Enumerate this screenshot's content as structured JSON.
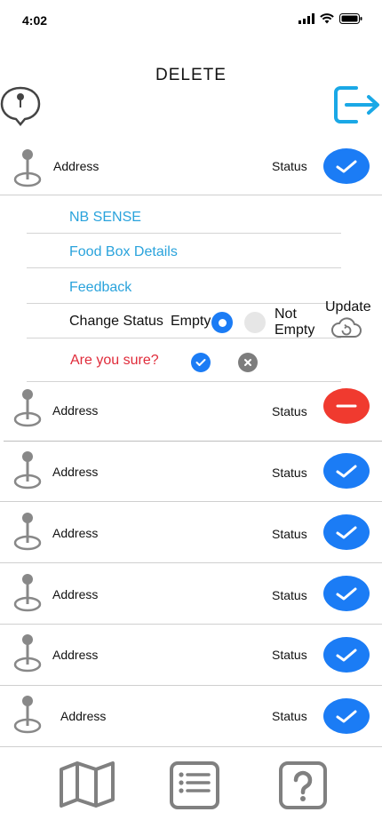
{
  "status_bar": {
    "time": "4:02"
  },
  "header": {
    "title": "DELETE"
  },
  "rows": [
    {
      "address": "Address",
      "status": "Status",
      "action": "check"
    },
    {
      "address": "Address",
      "status": "Status",
      "action": "minus"
    },
    {
      "address": "Address",
      "status": "Status",
      "action": "check"
    },
    {
      "address": "Address",
      "status": "Status",
      "action": "check"
    },
    {
      "address": "Address",
      "status": "Status",
      "action": "check"
    },
    {
      "address": "Address",
      "status": "Status",
      "action": "check"
    },
    {
      "address": "Address",
      "status": "Status",
      "action": "check"
    }
  ],
  "menu": {
    "nb_sense": "NB SENSE",
    "food_box_details": "Food Box Details",
    "feedback": "Feedback",
    "change_status": "Change Status",
    "option_empty": "Empty",
    "option_not_empty_line1": "Not",
    "option_not_empty_line2": "Empty",
    "selected_option": "Empty",
    "update": "Update",
    "confirm_prompt": "Are you sure?"
  },
  "colors": {
    "accent_blue": "#1b7cf5",
    "link_blue": "#2aa3dc",
    "delete_red": "#f03a2f",
    "warning_red": "#e02b3a",
    "icon_gray": "#888888"
  },
  "icons": {
    "header_left": "map-pin-bubble-icon",
    "header_right": "logout-icon",
    "row": "map-pin-icon",
    "update": "cloud-sync-icon",
    "nav": [
      "map-icon",
      "list-icon",
      "help-icon"
    ]
  }
}
